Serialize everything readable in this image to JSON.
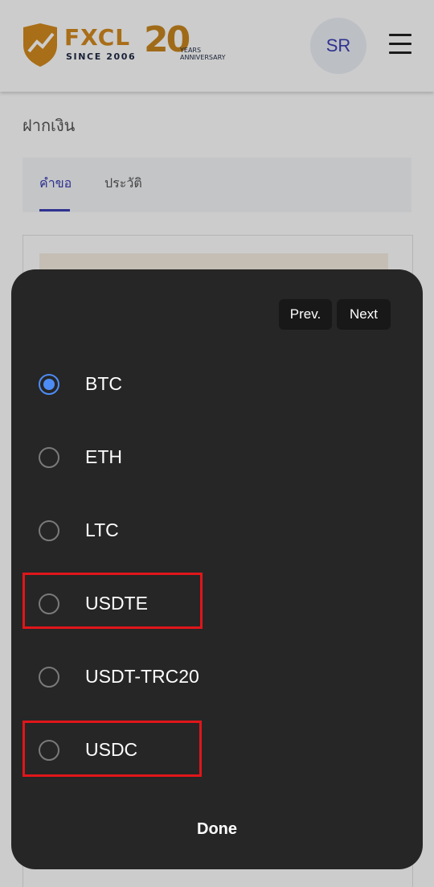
{
  "header": {
    "logo_name": "FXCL",
    "logo_since": "SINCE 2006",
    "logo_anniversary_number": "20",
    "logo_anniversary_text": "YEARS\nANNIVERSARY",
    "avatar_initials": "SR"
  },
  "page": {
    "title": "ฝากเงิน",
    "tabs": [
      {
        "label": "คำขอ",
        "active": true
      },
      {
        "label": "ประวัติ",
        "active": false
      }
    ]
  },
  "picker": {
    "prev_label": "Prev.",
    "next_label": "Next",
    "options": [
      {
        "label": "BTC",
        "selected": true,
        "highlighted": false
      },
      {
        "label": "ETH",
        "selected": false,
        "highlighted": false
      },
      {
        "label": "LTC",
        "selected": false,
        "highlighted": false
      },
      {
        "label": "USDTE",
        "selected": false,
        "highlighted": true
      },
      {
        "label": "USDT-TRC20",
        "selected": false,
        "highlighted": false
      },
      {
        "label": "USDC",
        "selected": false,
        "highlighted": true
      }
    ],
    "done_label": "Done"
  },
  "colors": {
    "brand_gold": "#d48a1e",
    "brand_navy": "#1f2a44",
    "accent_blue": "#3b3fb4",
    "radio_selected": "#4d8cf5",
    "sheet_bg": "#262626",
    "highlight_red": "#e0161a"
  },
  "icons": [
    "shield-logo-icon",
    "hamburger-menu-icon",
    "radio-button-icon"
  ]
}
